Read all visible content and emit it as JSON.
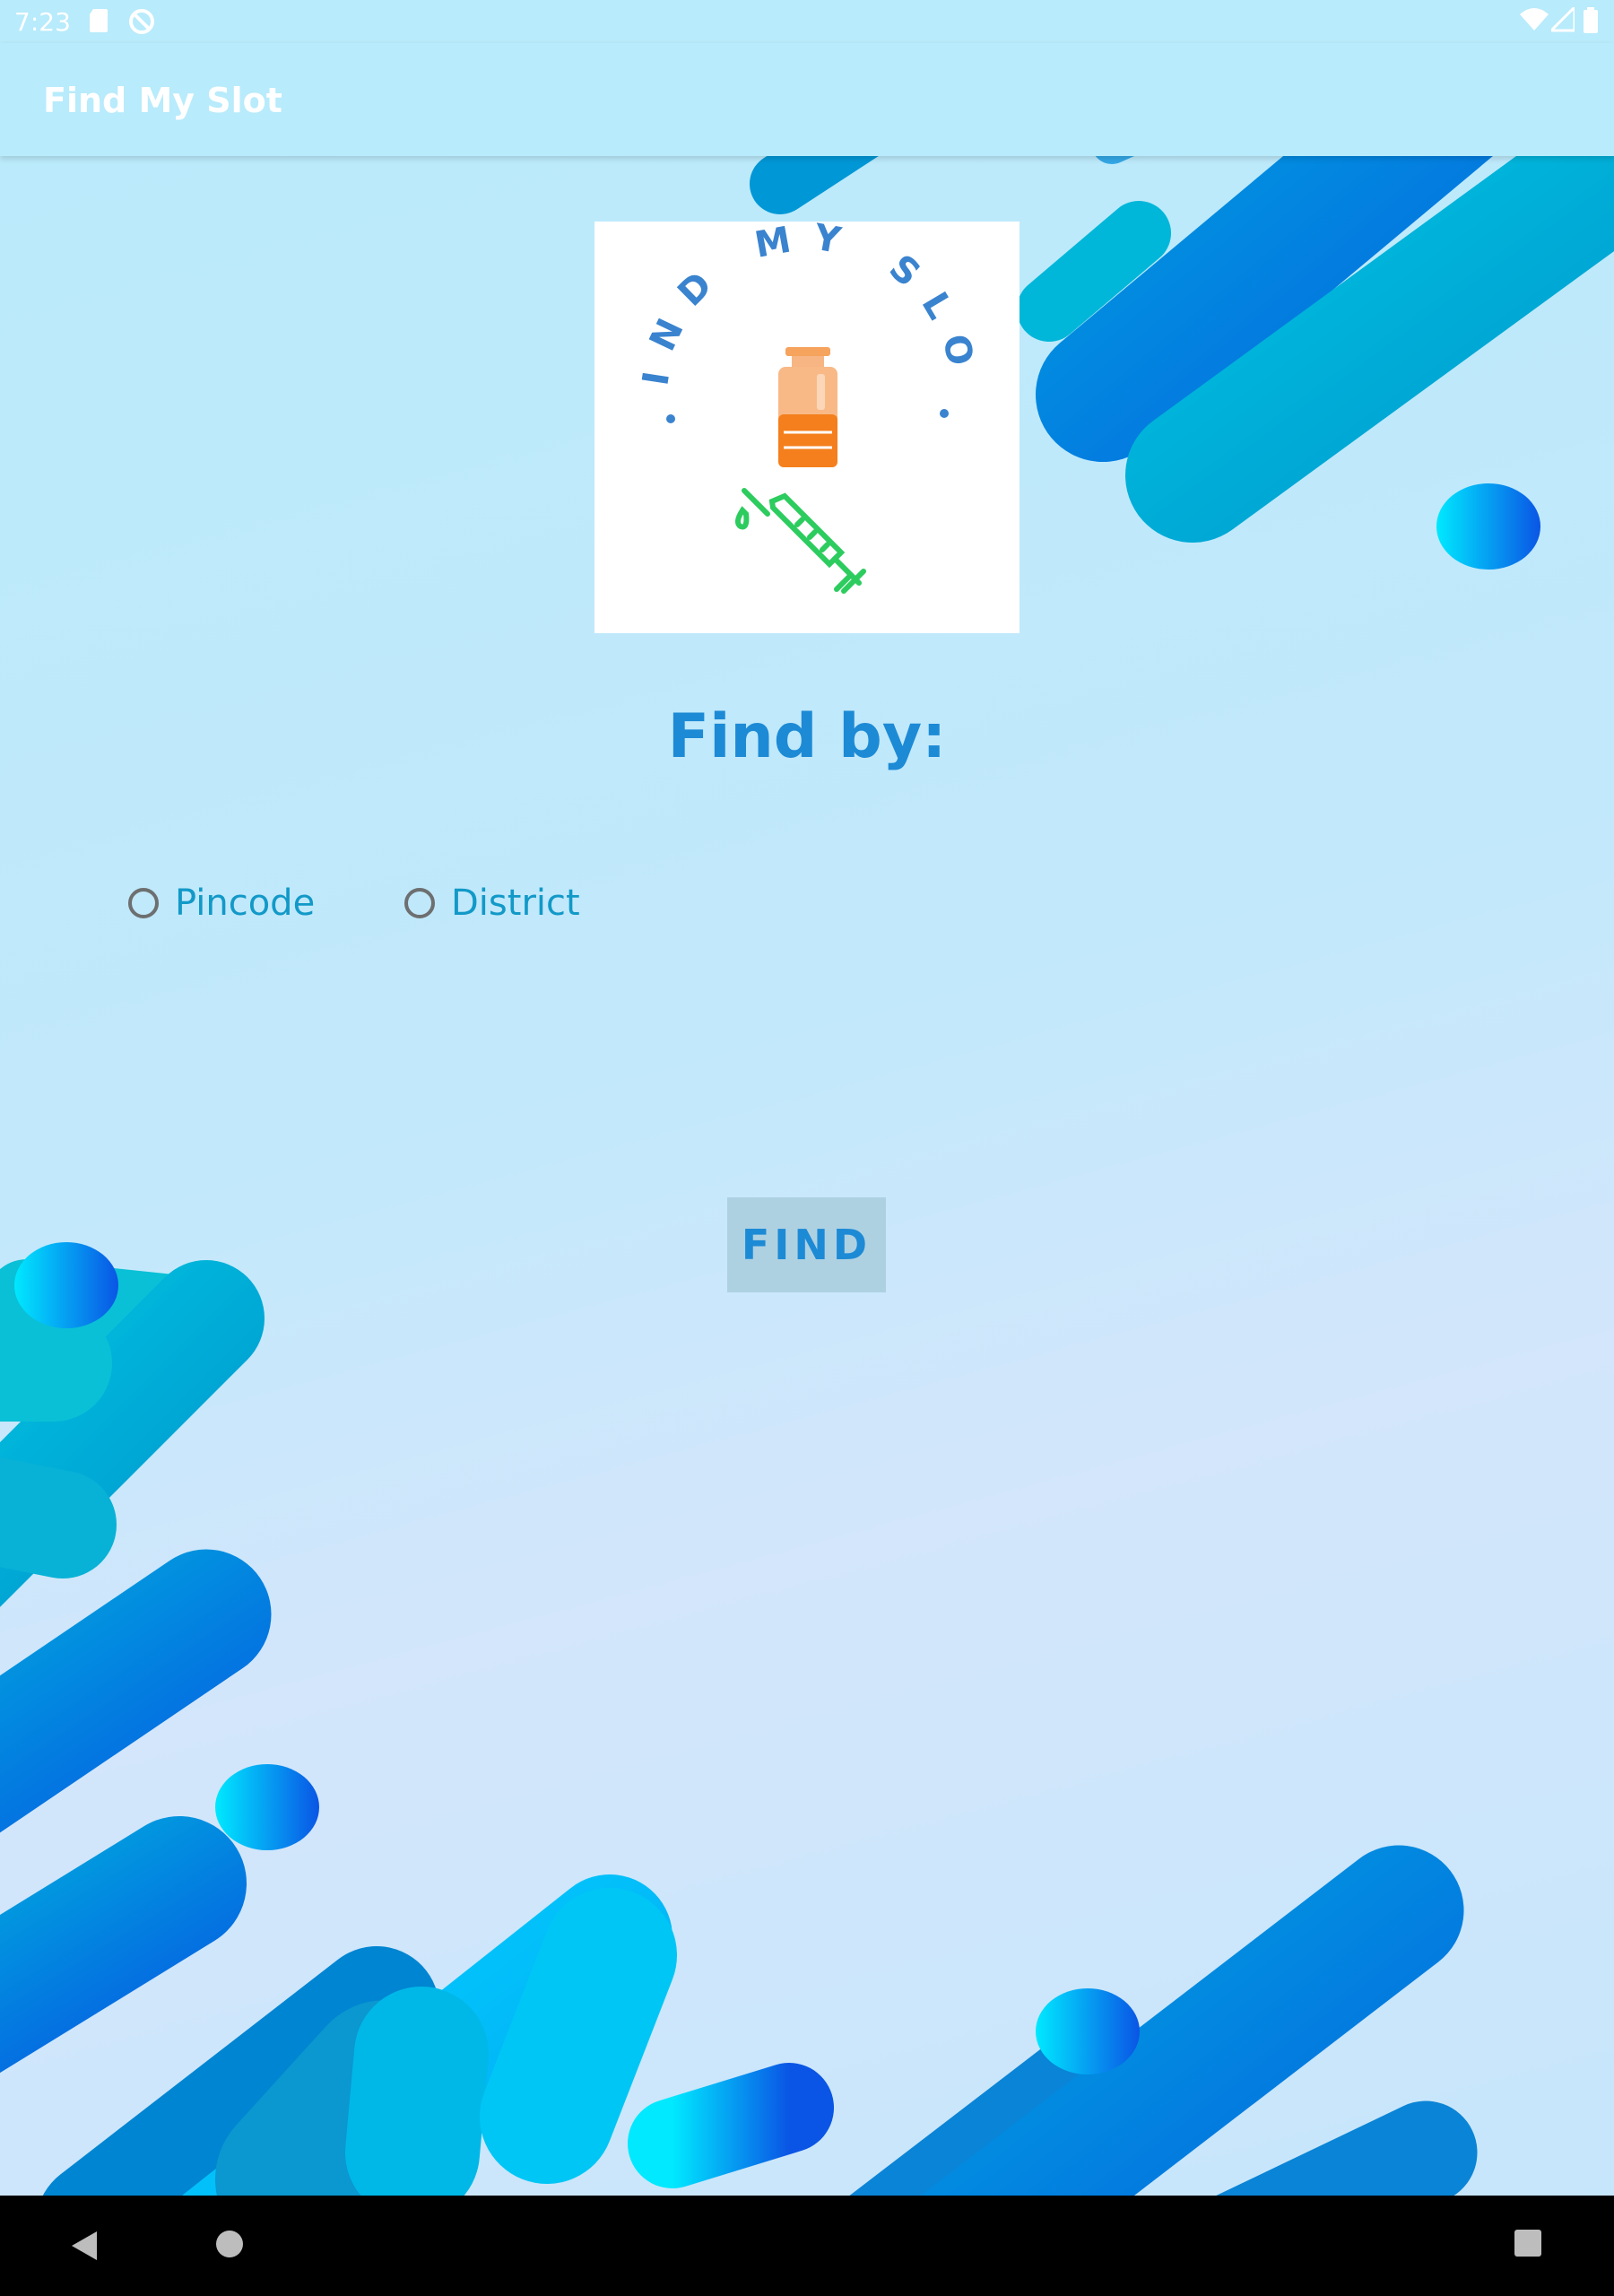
{
  "status_bar": {
    "time": "7:23",
    "left_icons": [
      "sd-card-icon",
      "sync-off-icon"
    ],
    "right_icons": [
      "wifi-icon",
      "signal-icon",
      "battery-icon"
    ]
  },
  "app_bar": {
    "title": "Find My Slot"
  },
  "logo": {
    "text": "FIND MY SLOT",
    "icons": [
      "vaccine-vial-icon",
      "syringe-icon"
    ]
  },
  "main": {
    "heading": "Find by:",
    "radio_options": [
      {
        "label": "Pincode",
        "selected": false
      },
      {
        "label": "District",
        "selected": false
      }
    ],
    "find_button_label": "FIND"
  },
  "nav_bar": {
    "buttons": [
      "back-icon",
      "home-icon",
      "recents-icon"
    ]
  },
  "colors": {
    "accent": "#1d8ad5",
    "radio_label": "#1299c8",
    "button_bg": "#aed1e2",
    "background": "#c4e8fb",
    "wave_dark": "#0a79d8",
    "wave_cyan": "#00c8f0"
  }
}
